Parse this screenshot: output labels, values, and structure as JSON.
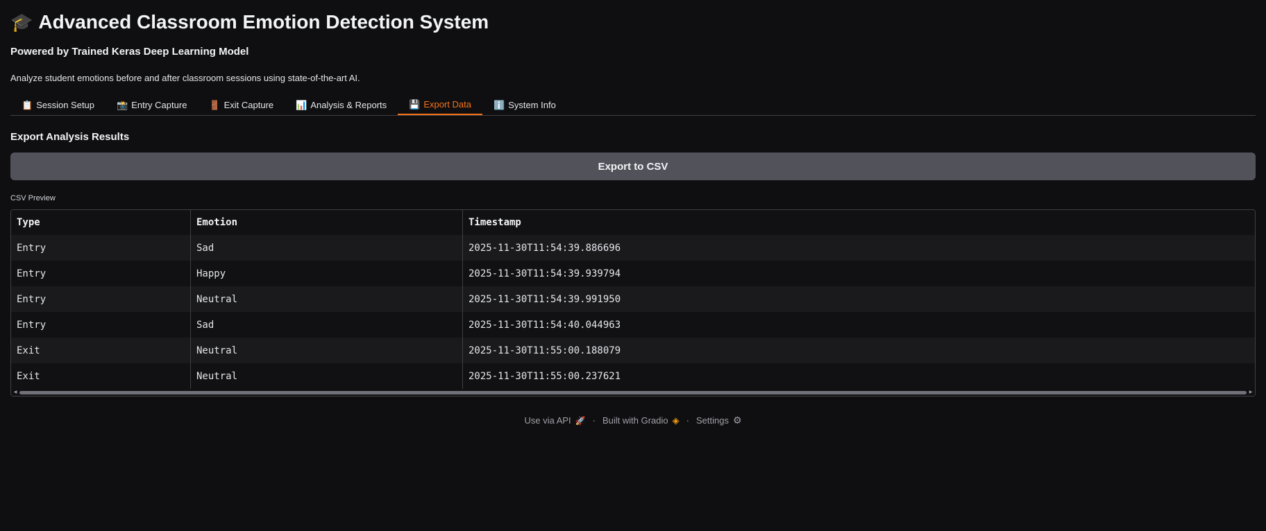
{
  "header": {
    "title_emoji": "🎓",
    "title": "Advanced Classroom Emotion Detection System",
    "subtitle": "Powered by Trained Keras Deep Learning Model",
    "description": "Analyze student emotions before and after classroom sessions using state-of-the-art AI."
  },
  "tabs": [
    {
      "icon": "📋",
      "label": "Session Setup"
    },
    {
      "icon": "📸",
      "label": "Entry Capture"
    },
    {
      "icon": "🚪",
      "label": "Exit Capture"
    },
    {
      "icon": "📊",
      "label": "Analysis & Reports"
    },
    {
      "icon": "💾",
      "label": "Export Data",
      "active": true
    },
    {
      "icon": "ℹ️",
      "label": "System Info"
    }
  ],
  "export": {
    "section_title": "Export Analysis Results",
    "button_label": "Export to CSV",
    "preview_label": "CSV Preview"
  },
  "table": {
    "headers": [
      "Type",
      "Emotion",
      "Timestamp"
    ],
    "rows": [
      [
        "Entry",
        "Sad",
        "2025-11-30T11:54:39.886696"
      ],
      [
        "Entry",
        "Happy",
        "2025-11-30T11:54:39.939794"
      ],
      [
        "Entry",
        "Neutral",
        "2025-11-30T11:54:39.991950"
      ],
      [
        "Entry",
        "Sad",
        "2025-11-30T11:54:40.044963"
      ],
      [
        "Exit",
        "Neutral",
        "2025-11-30T11:55:00.188079"
      ],
      [
        "Exit",
        "Neutral",
        "2025-11-30T11:55:00.237621"
      ]
    ]
  },
  "footer": {
    "api_label": "Use via API",
    "api_icon": "🚀",
    "built_label": "Built with Gradio",
    "gradio_icon": "◈",
    "settings_label": "Settings",
    "settings_icon": "⚙",
    "separator": "·"
  },
  "colors": {
    "accent": "#f97316",
    "background": "#0f0f11",
    "button": "#52525b"
  }
}
